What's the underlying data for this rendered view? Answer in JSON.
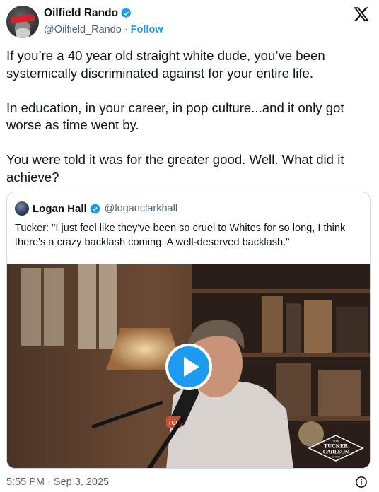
{
  "author": {
    "display_name": "Oilfield Rando",
    "handle": "@Oilfield_Rando",
    "separator": "·",
    "follow_label": "Follow",
    "verified_color": "#1d9bf0"
  },
  "tweet": {
    "paragraphs": [
      "If you’re a 40 year old straight white dude, you’ve been systemically discriminated against for your entire life.",
      "In education, in your career, in pop culture...and it only got worse as time went by.",
      "You were told it was for the greater good. Well. What did it achieve?"
    ],
    "timestamp": "5:55 PM · Sep 3, 2025"
  },
  "quote": {
    "display_name": "Logan Hall",
    "handle": "@loganclarkhall",
    "text": "Tucker: \"I just feel like they've been so cruel to Whites for so long, I think there's a crazy backlash coming. A well-deserved backlash.\"",
    "video": {
      "play_button_color": "#1d9bf0",
      "mic_badge": "TCN",
      "watermark_lines": [
        "THE",
        "TUCKER",
        "CARLSON",
        "SHOW"
      ]
    }
  },
  "icons": {
    "platform_logo": "x-logo-icon",
    "verified": "verified-badge-icon",
    "info": "info-icon"
  }
}
